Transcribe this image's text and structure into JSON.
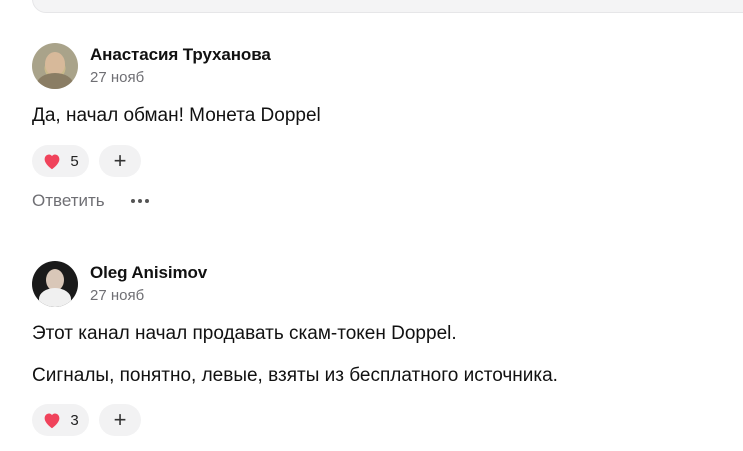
{
  "comments": [
    {
      "author": "Анастасия Труханова",
      "date": "27 нояб",
      "paragraphs": [
        "Да, начал обман! Монета Doppel"
      ],
      "likes": "5",
      "add_label": "+",
      "reply_label": "Ответить",
      "more_icon": "more-icon"
    },
    {
      "author": "Oleg Anisimov",
      "date": "27 нояб",
      "paragraphs": [
        "Этот канал начал продавать скам-токен Doppel.",
        "Сигналы, понятно, левые, взяты из бесплатного источника."
      ],
      "likes": "3",
      "add_label": "+"
    }
  ],
  "colors": {
    "heart": "#f0435b",
    "pill_bg": "#f2f2f3",
    "muted_text": "#6f6f74"
  }
}
